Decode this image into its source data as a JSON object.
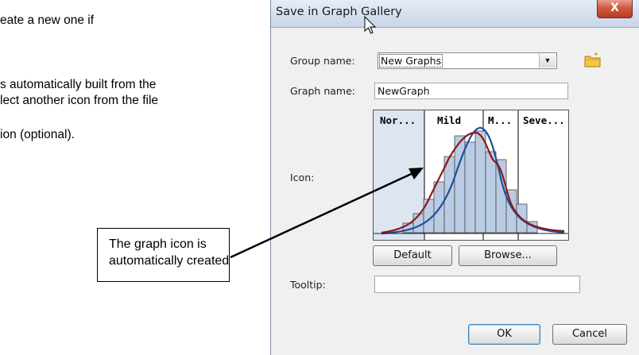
{
  "doc": {
    "lines": [
      "eate a new one if",
      "s automatically built from the",
      "lect another icon from the file",
      "ion (optional)."
    ],
    "callout": [
      "The graph icon is",
      "automatically created"
    ]
  },
  "dialog": {
    "title": "Save in Graph Gallery",
    "close_label": "X",
    "group_label": "Group name:",
    "group_value": "New Graphs",
    "graph_label": "Graph name:",
    "graph_value": "NewGraph",
    "icon_label": "Icon:",
    "icon_categories": [
      "Nor...",
      "Mild",
      "M...",
      "Seve..."
    ],
    "default_button": "Default",
    "browse_button": "Browse...",
    "tooltip_label": "Tooltip:",
    "tooltip_value": "",
    "ok_button": "OK",
    "cancel_button": "Cancel",
    "icons": [
      "close-icon",
      "dropdown-arrow-icon",
      "new-folder-icon",
      "mouse-cursor-icon"
    ]
  },
  "colors": {
    "bars": "#b9cce4",
    "normal_region": "#dde5f1",
    "blue_curve": "#1f4e9a",
    "red_curve": "#8b1a1a"
  }
}
